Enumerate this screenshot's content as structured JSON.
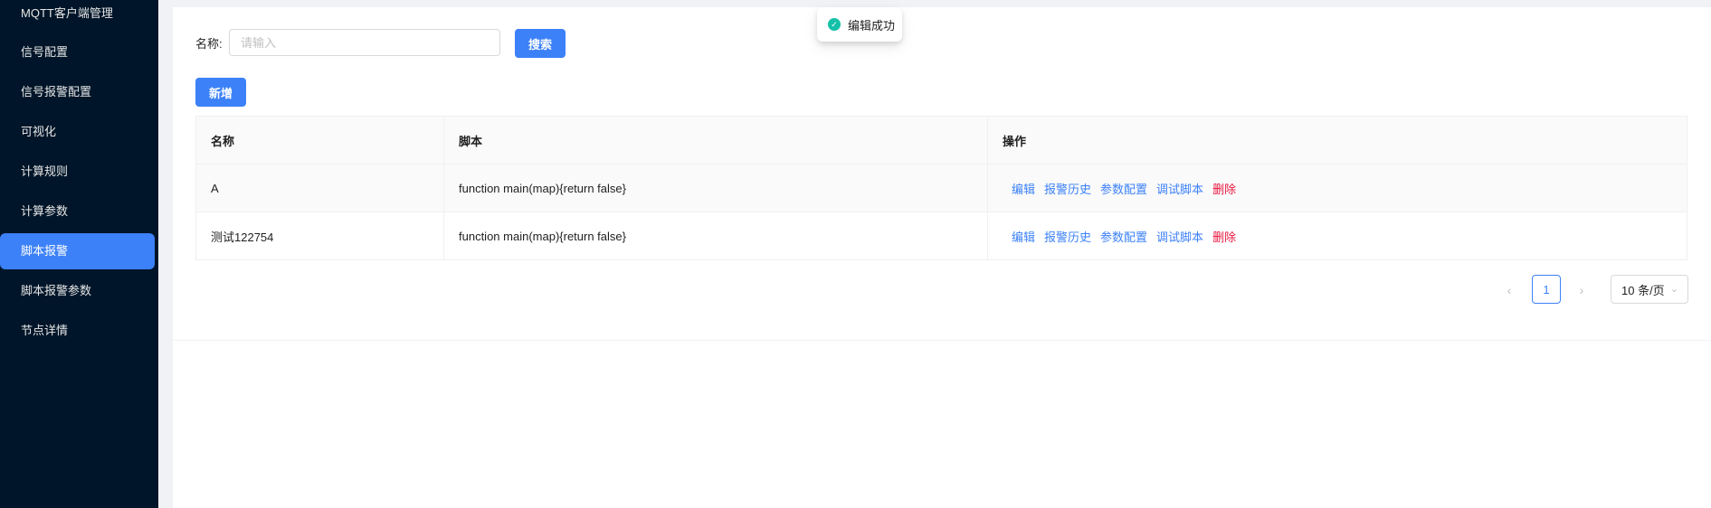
{
  "sidebar": {
    "items": [
      {
        "label": "MQTT客户端管理",
        "active": false
      },
      {
        "label": "信号配置",
        "active": false
      },
      {
        "label": "信号报警配置",
        "active": false
      },
      {
        "label": "可视化",
        "active": false
      },
      {
        "label": "计算规则",
        "active": false
      },
      {
        "label": "计算参数",
        "active": false
      },
      {
        "label": "脚本报警",
        "active": true
      },
      {
        "label": "脚本报警参数",
        "active": false
      },
      {
        "label": "节点详情",
        "active": false
      }
    ]
  },
  "search": {
    "label": "名称:",
    "placeholder": "请输入",
    "value": "",
    "button": "搜索"
  },
  "toolbar": {
    "add_label": "新增"
  },
  "table": {
    "columns": [
      "名称",
      "脚本",
      "操作"
    ],
    "rows": [
      {
        "name": "A",
        "script": "function main(map){return false}"
      },
      {
        "name": "测试122754",
        "script": "function main(map){return false}"
      }
    ],
    "actions": [
      "编辑",
      "报警历史",
      "参数配置",
      "调试脚本",
      "删除"
    ]
  },
  "pagination": {
    "current_page": "1",
    "page_size": "10 条/页",
    "prev_icon": "chevron-left-icon",
    "next_icon": "chevron-right-icon"
  },
  "toast": {
    "message": "编辑成功",
    "icon": "check-circle-icon"
  },
  "colors": {
    "primary": "#3c81f8",
    "danger": "#e8173f",
    "sidebar_bg": "#001529",
    "success": "#15c0a8"
  }
}
